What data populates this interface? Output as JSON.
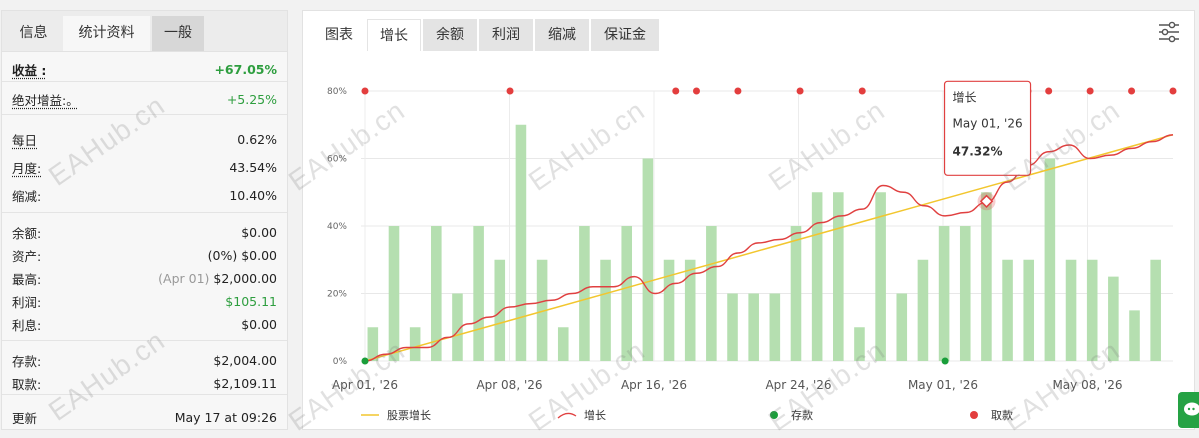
{
  "left_tabs": [
    "信息",
    "统计资料",
    "一般"
  ],
  "stats": [
    {
      "label": "收益 :",
      "value": "+67.05%",
      "style": "greenb",
      "kstyle": "bu"
    },
    {
      "label": "绝对增益:。",
      "value": "+5.25%",
      "style": "green",
      "kstyle": "u"
    },
    {
      "label": "每日",
      "value": "0.62%",
      "kstyle": "u"
    },
    {
      "label": "月度:",
      "value": "43.54%",
      "kstyle": "u"
    },
    {
      "label": "缩减:",
      "value": "10.40%"
    },
    {
      "label": "余额:",
      "value": "$0.00"
    },
    {
      "label": "资产:",
      "value": "(0%) $0.00"
    },
    {
      "label": "最高:",
      "value_muted": "(Apr 01)",
      "value": "$2,000.00"
    },
    {
      "label": "利润:",
      "value": "$105.11",
      "style": "green"
    },
    {
      "label": "利息:",
      "value": "$0.00"
    },
    {
      "label": "存款:",
      "value": "$2,004.00"
    },
    {
      "label": "取款:",
      "value": "$2,109.11"
    },
    {
      "label": "更新",
      "value": "May 17 at 09:26"
    }
  ],
  "right_tabs": [
    "图表",
    "增长",
    "余额",
    "利润",
    "缩减",
    "保证金"
  ],
  "watermark": "EAHub.cn",
  "tooltip": {
    "title": "增长",
    "date": "May 01, '26",
    "value": "47.32%"
  },
  "colors": {
    "bar": "#b5dfb0",
    "growth_line": "#e04040",
    "equity_line": "#f2c62e",
    "deposit": "#1a9e3a",
    "withdrawal": "#e33e3e",
    "green_text": "#2e9e3f"
  },
  "chart_data": {
    "type": "bar+line",
    "x_tick_labels": [
      "Apr 01, '26",
      "Apr 08, '26",
      "Apr 16, '26",
      "Apr 24, '26",
      "May 01, '26",
      "May 08, '26"
    ],
    "y_tick_labels": [
      "0%",
      "20%",
      "40%",
      "60%",
      "80%"
    ],
    "ylim": [
      0,
      80
    ],
    "grid": true,
    "legend_position": "bottom",
    "legend": [
      "股票增长",
      "增长",
      "存款",
      "取款"
    ],
    "bars_pct": [
      10,
      40,
      10,
      40,
      20,
      40,
      30,
      70,
      30,
      10,
      40,
      30,
      40,
      60,
      30,
      30,
      40,
      20,
      20,
      20,
      40,
      50,
      50,
      10,
      50,
      20,
      30,
      40,
      40,
      50,
      30,
      30,
      60,
      30,
      30,
      25,
      15,
      30
    ],
    "growth_pct": [
      0,
      2,
      4,
      4,
      7,
      11,
      13,
      16,
      17,
      18,
      20,
      22,
      22,
      25,
      20,
      23,
      26,
      28,
      32,
      35,
      36,
      38,
      41,
      43,
      45,
      52,
      50,
      46,
      43,
      44,
      47,
      53,
      58,
      62,
      64,
      60,
      61,
      63,
      65,
      67
    ],
    "equity_growth_pct": [
      0,
      67.05
    ],
    "deposit_points": [
      0,
      28
    ],
    "withdrawal_points": [
      0,
      7,
      15,
      16,
      18,
      21,
      24,
      29,
      31,
      32,
      33,
      35,
      37,
      39
    ]
  }
}
